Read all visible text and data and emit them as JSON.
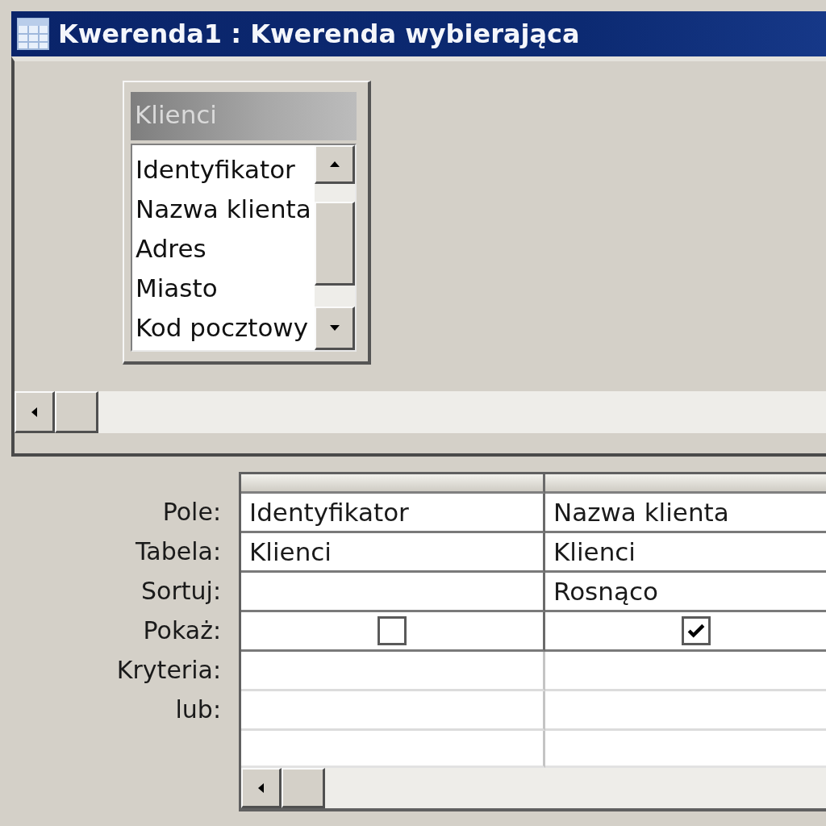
{
  "window": {
    "title": "Kwerenda1 : Kwerenda wybierająca"
  },
  "field_list": {
    "title": "Klienci",
    "fields": [
      "Identyfikator",
      "Nazwa klienta",
      "Adres",
      "Miasto",
      "Kod pocztowy"
    ]
  },
  "grid": {
    "rows": [
      {
        "label": "Pole:",
        "kind": "field"
      },
      {
        "label": "Tabela:",
        "kind": "table"
      },
      {
        "label": "Sortuj:",
        "kind": "sort"
      },
      {
        "label": "Pokaż:",
        "kind": "show"
      },
      {
        "label": "Kryteria:",
        "kind": "criteria"
      },
      {
        "label": "lub:",
        "kind": "or"
      }
    ],
    "columns": [
      {
        "field": "Identyfikator",
        "table": "Klienci",
        "show": false
      },
      {
        "field": "Nazwa klienta",
        "table": "Klienci",
        "sort": "Rosnąco",
        "show": true
      }
    ]
  }
}
